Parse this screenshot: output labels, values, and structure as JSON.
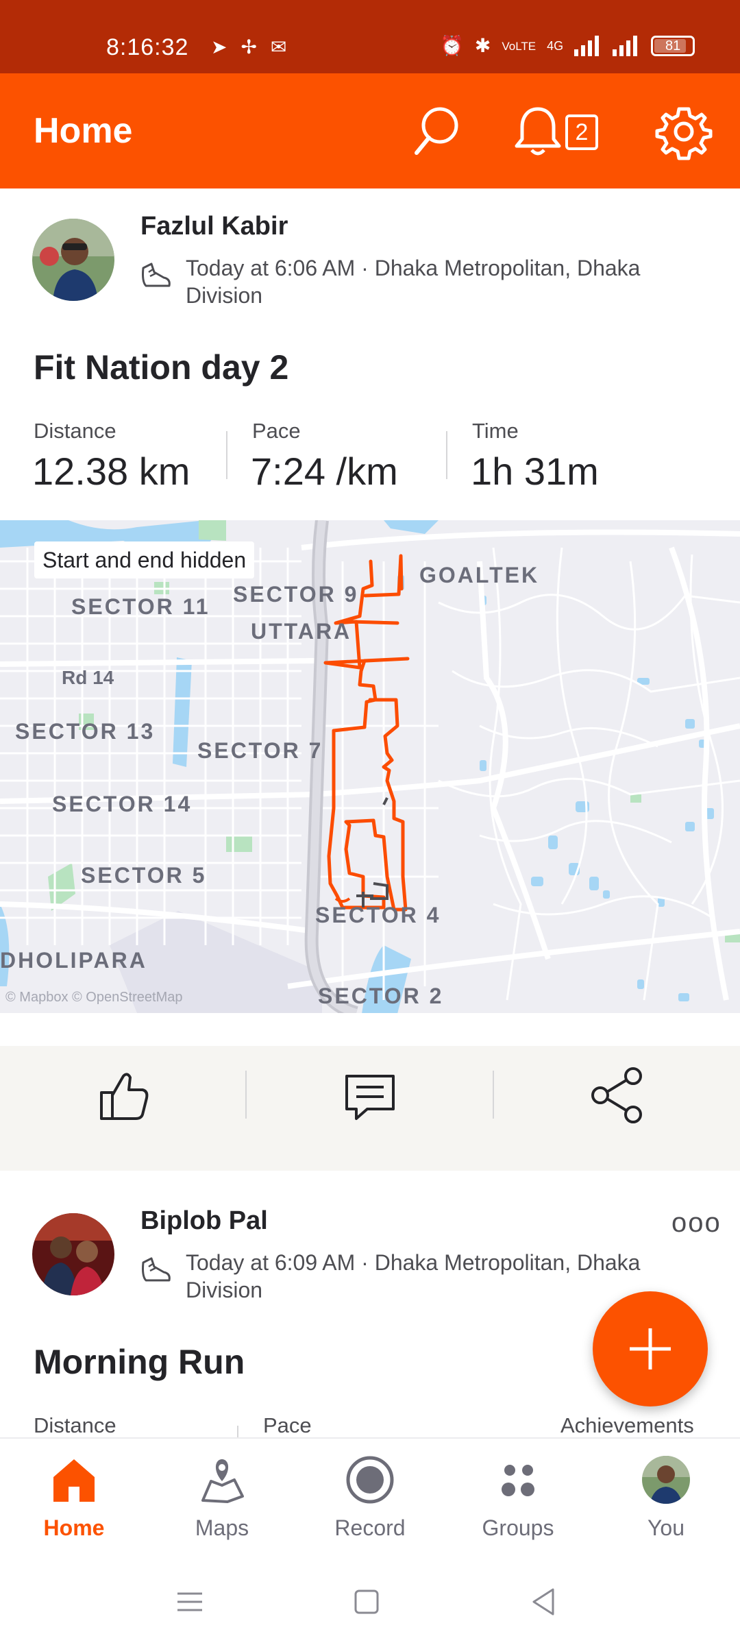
{
  "status_bar": {
    "time": "8:16:32",
    "battery": "81",
    "network": "4G",
    "volte": "VoLTE"
  },
  "header": {
    "title": "Home",
    "notification_count": "2"
  },
  "post1": {
    "athlete": "Fazlul Kabir",
    "meta_line1": "Today at 6:06 AM · Dhaka Metropolitan, Dhaka",
    "meta_line2": "Division",
    "title": "Fit Nation day 2",
    "stats": [
      {
        "label": "Distance",
        "value": "12.38 km"
      },
      {
        "label": "Pace",
        "value": "7:24 /km"
      },
      {
        "label": "Time",
        "value": "1h 31m"
      }
    ],
    "map": {
      "badge": "Start and end hidden",
      "labels": {
        "sector11": "SECTOR 11",
        "sector9": "SECTOR 9",
        "goaltek": "GOALTEK",
        "uttara": "UTTARA",
        "rd14": "Rd 14",
        "sector13": "SECTOR 13",
        "sector7": "SECTOR 7",
        "sector14": "SECTOR 14",
        "sector5": "SECTOR 5",
        "sector4": "SECTOR 4",
        "dholipara": "DHOLIPARA",
        "sector2": "SECTOR 2"
      },
      "attribution": "© Mapbox © OpenStreetMap"
    }
  },
  "post2": {
    "athlete": "Biplob Pal",
    "meta_line1": "Today at 6:09 AM · Dhaka Metropolitan, Dhaka",
    "meta_line2": "Division",
    "title": "Morning Run",
    "stats": [
      {
        "label": "Distance"
      },
      {
        "label": "Pace"
      },
      {
        "label": "Achievements"
      }
    ],
    "more": "ooo"
  },
  "nav": {
    "items": [
      {
        "label": "Home",
        "icon": "home-icon"
      },
      {
        "label": "Maps",
        "icon": "maps-icon"
      },
      {
        "label": "Record",
        "icon": "record-icon"
      },
      {
        "label": "Groups",
        "icon": "groups-icon"
      },
      {
        "label": "You",
        "icon": "avatar"
      }
    ]
  },
  "colors": {
    "brand": "#fc5200",
    "status_bar": "#b32b06",
    "route": "#fc4c02"
  }
}
